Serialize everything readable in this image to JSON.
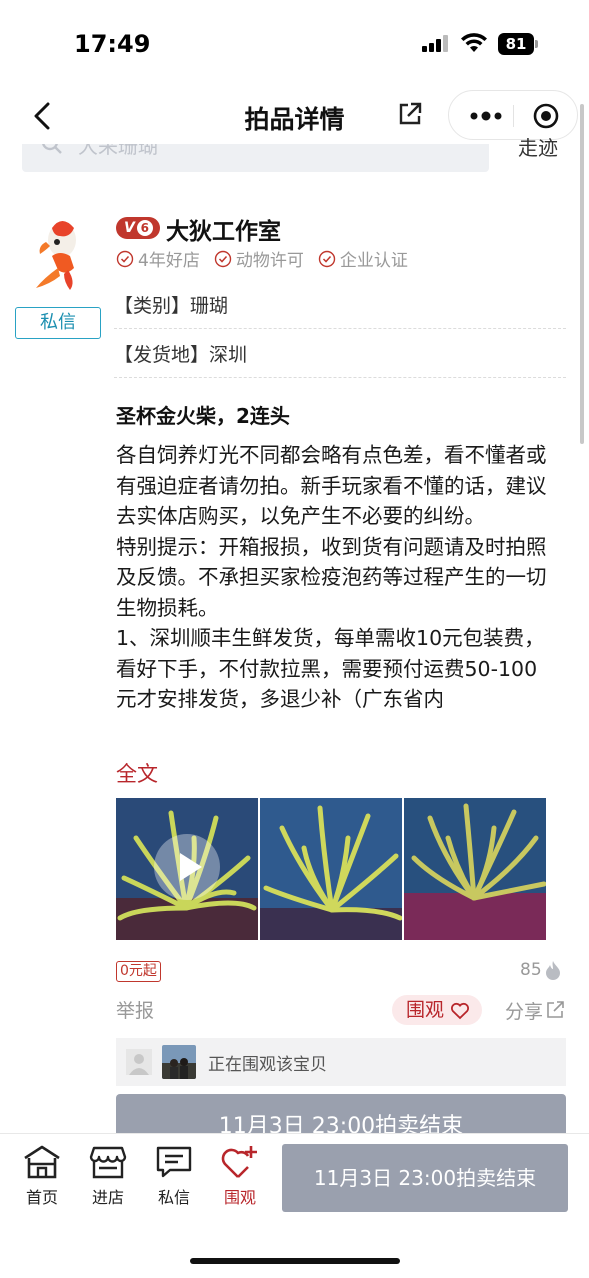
{
  "status_bar": {
    "time": "17:49",
    "battery": "81"
  },
  "navbar": {
    "title": "拍品详情",
    "back_icon": "chevron-left-icon",
    "external_icon": "external-link-icon",
    "more_icon": "more-dots-icon",
    "close_icon": "target-icon"
  },
  "search": {
    "placeholder": "大采珊瑚",
    "right_label": "走迹"
  },
  "shop": {
    "vip_label": "V",
    "vip_level": "6",
    "name": "大狄工作室",
    "certs": [
      "4年好店",
      "动物许可",
      "企业认证"
    ],
    "dm_button": "私信",
    "category": "【类别】珊瑚",
    "ship_from": "【发货地】深圳"
  },
  "item": {
    "title": "圣杯金火柴，2连头",
    "description": "各自饲养灯光不同都会略有点色差，看不懂者或有强迫症者请勿拍。新手玩家看不懂的话，建议去实体店购买，以免产生不必要的纠纷。\n特别提示：开箱报损，收到货有问题请及时拍照及反馈。不承担买家检疫泡药等过程产生的一切生物损耗。\n1、深圳顺丰生鲜发货，每单需收10元包装费，看好下手，不付款拉黑，需要预付运费50-100元才安排发货，多退少补（广东省内",
    "full_text_link": "全文",
    "start_badge": "0元起",
    "heat": "85",
    "report": "举报",
    "watch": "围观",
    "share": "分享",
    "watchers_text": "正在围观该宝贝",
    "end_notice": "11月3日 23:00拍卖结束"
  },
  "tabbar": {
    "tabs": [
      {
        "label": "首页",
        "icon": "home-icon"
      },
      {
        "label": "进店",
        "icon": "store-icon"
      },
      {
        "label": "私信",
        "icon": "message-icon"
      },
      {
        "label": "围观",
        "icon": "heart-plus-icon"
      }
    ],
    "end_button": "11月3日 23:00拍卖结束"
  },
  "colors": {
    "accent": "#b8262b",
    "dm_blue": "#1b8fb0",
    "disabled": "#9aa0ae"
  }
}
